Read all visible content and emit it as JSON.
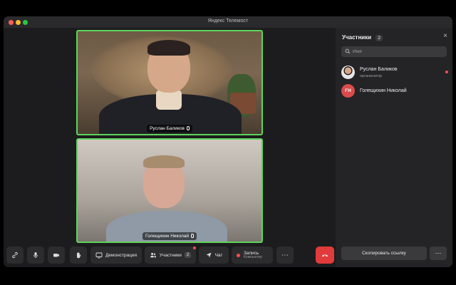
{
  "window": {
    "title": "Яндекс Телемост"
  },
  "participants_tiles": [
    {
      "name": "Руслан Баликов"
    },
    {
      "name": "Голещихин Николай"
    }
  ],
  "toolbar": {
    "demo_label": "Демонстрация",
    "participants_label": "Участники",
    "participants_count": "2",
    "chat_label": "Чат",
    "record_label": "Запись",
    "record_sub": "Компьютер",
    "more_label": "⋯"
  },
  "panel": {
    "title": "Участники",
    "count": "2",
    "close_label": "×",
    "search_placeholder": "Имя",
    "participants": [
      {
        "name": "Руслан Баликов",
        "role": "организатор"
      },
      {
        "name": "Голещихин Николай",
        "initials": "ГН"
      }
    ],
    "copy_link_label": "Скопировать ссылку",
    "more_label": "⋯"
  },
  "colors": {
    "active_border": "#5fd35a",
    "hangup": "#e23b3b",
    "avatar_initials_bg": "#d94b4b"
  },
  "icons": [
    "link-icon",
    "mic-icon",
    "camera-icon",
    "hand-icon",
    "screen-share-icon",
    "participants-icon",
    "chat-icon",
    "record-icon",
    "more-icon",
    "hangup-icon",
    "search-icon",
    "close-icon"
  ]
}
